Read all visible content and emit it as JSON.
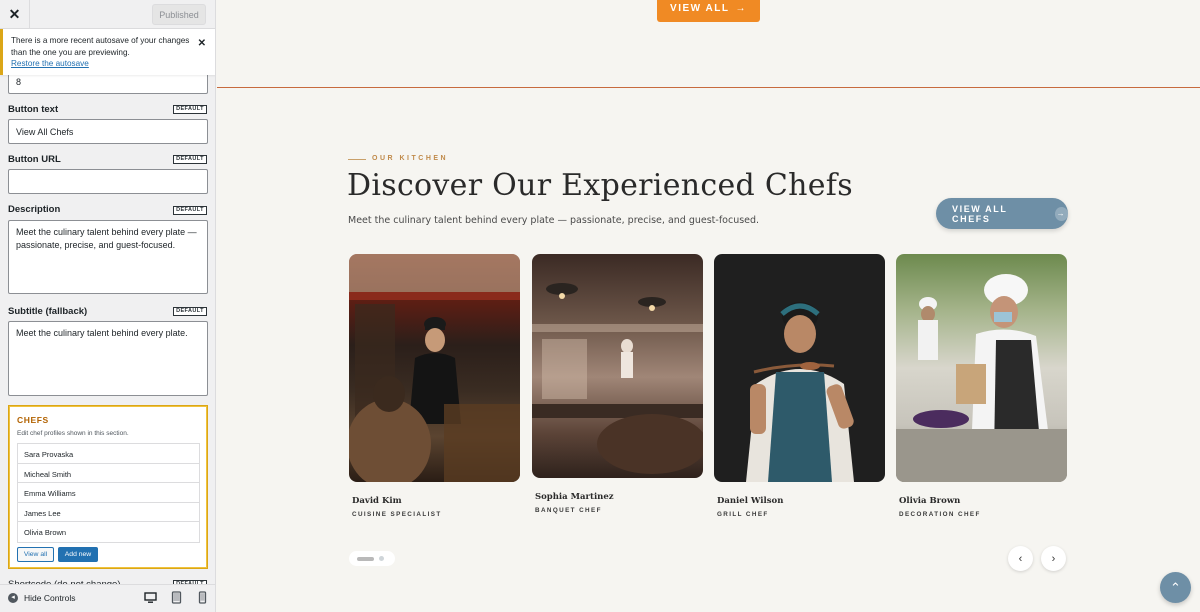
{
  "topbar": {
    "close_icon": "close-icon",
    "publish_label": "Published"
  },
  "notice": {
    "text": "There is a more recent autosave of your changes than the one you are previewing.",
    "link": "Restore the autosave"
  },
  "fields": {
    "count_value": "8",
    "default_chip": "DEFAULT",
    "button_text_label": "Button text",
    "button_text_value": "View All Chefs",
    "button_url_label": "Button URL",
    "button_url_value": "",
    "description_label": "Description",
    "description_value": "Meet the culinary talent behind every plate — passionate, precise, and guest-focused.",
    "subtitle_label": "Subtitle (fallback)",
    "subtitle_value": "Meet the culinary talent behind every plate.",
    "shortcode_label": "Shortcode (do not change)"
  },
  "chefs_panel": {
    "title": "CHEFS",
    "description": "Edit chef profiles shown in this section.",
    "items": [
      "Sara Provaska",
      "Micheal Smith",
      "Emma Williams",
      "James Lee",
      "Olivia Brown"
    ],
    "view_all": "View all",
    "add_new": "Add new"
  },
  "footer": {
    "hide_controls": "Hide Controls"
  },
  "preview": {
    "top_button": "VIEW ALL",
    "eyebrow": "OUR KITCHEN",
    "heading": "Discover Our Experienced Chefs",
    "subtext": "Meet the culinary talent behind every plate — passionate, precise, and guest-focused.",
    "cta": "VIEW ALL CHEFS",
    "cards": [
      {
        "name": "David Kim",
        "role": "CUISINE SPECIALIST"
      },
      {
        "name": "Sophia Martinez",
        "role": "BANQUET CHEF"
      },
      {
        "name": "Daniel Wilson",
        "role": "GRILL CHEF"
      },
      {
        "name": "Olivia Brown",
        "role": "DECORATION CHEF"
      }
    ]
  },
  "colors": {
    "accent_orange": "#f08a24",
    "pill_blue": "#6e8fa6",
    "wp_blue": "#2271b1",
    "notice_yellow": "#dba617"
  }
}
